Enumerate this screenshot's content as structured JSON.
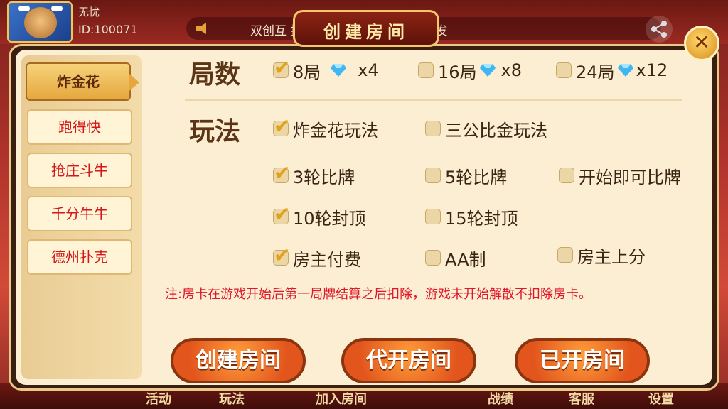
{
  "user": {
    "name": "无忧",
    "id": "ID:100071"
  },
  "marquee": "双创互        报，整套完整软件，改名开发",
  "bottom_menu": [
    "活动",
    "玩法",
    "加入房间",
    "战绩",
    "客服",
    "设置"
  ],
  "dialog": {
    "title": "创建房间",
    "close_label": "✕",
    "sidebar": [
      {
        "label": "炸金花",
        "active": true
      },
      {
        "label": "跑得快",
        "active": false
      },
      {
        "label": "抢庄斗牛",
        "active": false
      },
      {
        "label": "千分牛牛",
        "active": false
      },
      {
        "label": "德州扑克",
        "active": false
      }
    ],
    "rounds": {
      "title": "局数",
      "options": [
        {
          "label": "8局",
          "cost": "x4",
          "checked": true
        },
        {
          "label": "16局",
          "cost": "x8",
          "checked": false
        },
        {
          "label": "24局",
          "cost": "x12",
          "checked": false
        }
      ]
    },
    "play": {
      "title": "玩法",
      "rows": [
        [
          {
            "label": "炸金花玩法",
            "checked": true
          },
          {
            "label": "三公比金玩法",
            "checked": false
          }
        ],
        [
          {
            "label": "3轮比牌",
            "checked": true
          },
          {
            "label": "5轮比牌",
            "checked": false
          },
          {
            "label": "开始即可比牌",
            "checked": false
          }
        ],
        [
          {
            "label": "10轮封顶",
            "checked": true
          },
          {
            "label": "15轮封顶",
            "checked": false
          }
        ],
        [
          {
            "label": "房主付费",
            "checked": true
          },
          {
            "label": "AA制",
            "checked": false
          },
          {
            "label": "房主上分",
            "checked": false
          }
        ]
      ]
    },
    "note": "注:房卡在游戏开始后第一局牌结算之后扣除，游戏未开始解散不扣除房卡。",
    "buttons": {
      "create": "创建房间",
      "proxy": "代开房间",
      "opened": "已开房间"
    }
  },
  "colors": {
    "accent": "#e2561d",
    "note": "#e0172a",
    "check": "#e2a21c"
  }
}
